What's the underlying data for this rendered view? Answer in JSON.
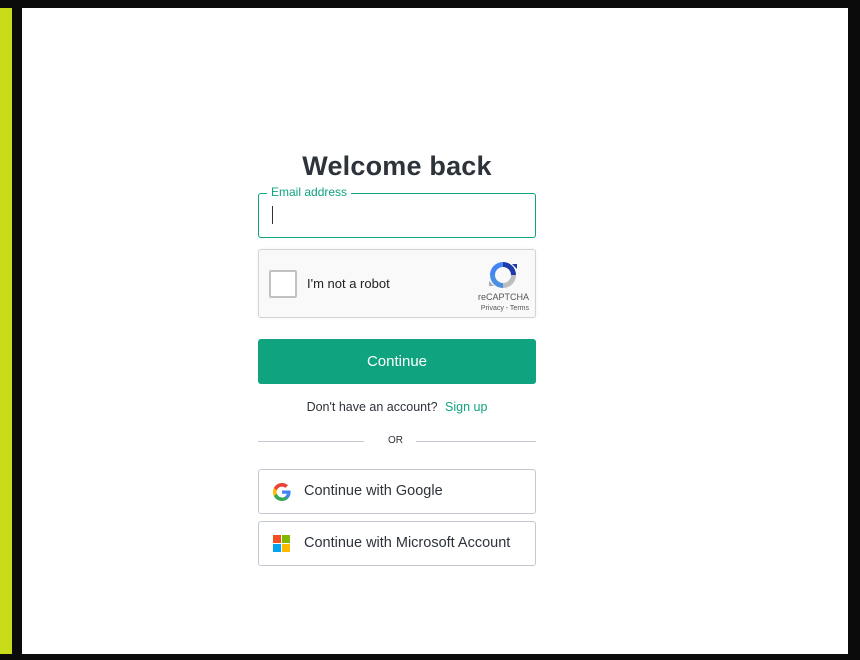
{
  "login": {
    "title": "Welcome back",
    "email": {
      "label": "Email address",
      "value": "",
      "placeholder": ""
    },
    "captcha": {
      "label": "I'm not a robot",
      "brand": "reCAPTCHA",
      "links": "Privacy - Terms",
      "checked": false
    },
    "continue_label": "Continue",
    "signup_prompt": "Don't have an account?",
    "signup_link": "Sign up",
    "divider_text": "OR",
    "social": {
      "google_label": "Continue with Google",
      "microsoft_label": "Continue with Microsoft Account"
    }
  },
  "icons": {
    "google": "google-logo-icon",
    "microsoft": "microsoft-logo-icon",
    "recaptcha": "recaptcha-logo-icon"
  },
  "colors": {
    "accent": "#10a37f",
    "text": "#2d333a",
    "border": "#c2c8d0",
    "frame_outer": "#c8dc1a",
    "frame_inner": "#0b0b0b"
  }
}
